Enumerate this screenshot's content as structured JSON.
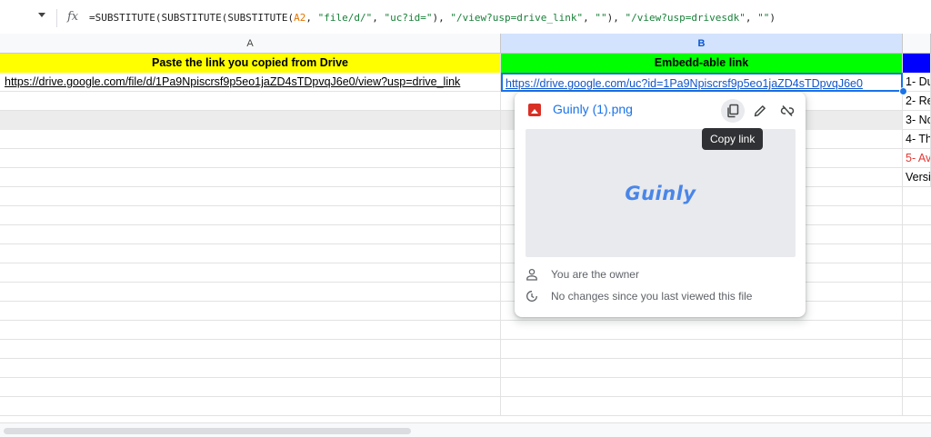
{
  "formula_bar": {
    "fx_label": "fx",
    "parts": {
      "p1": "=SUBSTITUTE(SUBSTITUTE(SUBSTITUTE(",
      "ref": "A2",
      "p2": ", ",
      "s1": "\"file/d/\"",
      "p3": ", ",
      "s2": "\"uc?id=\"",
      "p4": "), ",
      "s3": "\"/view?usp=drive_link\"",
      "p5": ", ",
      "s4": "\"\"",
      "p6": "), ",
      "s5": "\"/view?usp=drivesdk\"",
      "p7": ", ",
      "s6": "\"\"",
      "p8": ")"
    }
  },
  "columns": {
    "a": "A",
    "b": "B"
  },
  "header_row": {
    "a": "Paste the link you copied from Drive",
    "b": "Embedd-able link"
  },
  "row2": {
    "a": "https://drive.google.com/file/d/1Pa9Npiscrsf9p5eo1jaZD4sTDpvqJ6e0/view?usp=drive_link",
    "b": "https://drive.google.com/uc?id=1Pa9Npiscrsf9p5eo1jaZD4sTDpvqJ6e0"
  },
  "column_c_texts": [
    "1- Du",
    "2- Re",
    "3- No",
    "4- Th",
    "5- Av",
    "Versi"
  ],
  "link_card": {
    "file_name": "Guinly (1).png",
    "preview_logo": "Guinly",
    "owner_text": "You are the owner",
    "changes_text": "No changes since you last viewed this file"
  },
  "tooltip": {
    "label": "Copy link"
  },
  "colors": {
    "header_a_bg": "#ffff00",
    "header_b_bg": "#00ff00",
    "header_c_bg": "#0000ff",
    "link_blue": "#1155cc",
    "selection_blue": "#1a73e8",
    "red_text": "#e53935"
  },
  "icons": [
    "dropdown-arrow-icon",
    "fx-icon",
    "image-file-icon",
    "copy-icon",
    "edit-pencil-icon",
    "unlink-icon",
    "person-icon",
    "history-icon"
  ]
}
